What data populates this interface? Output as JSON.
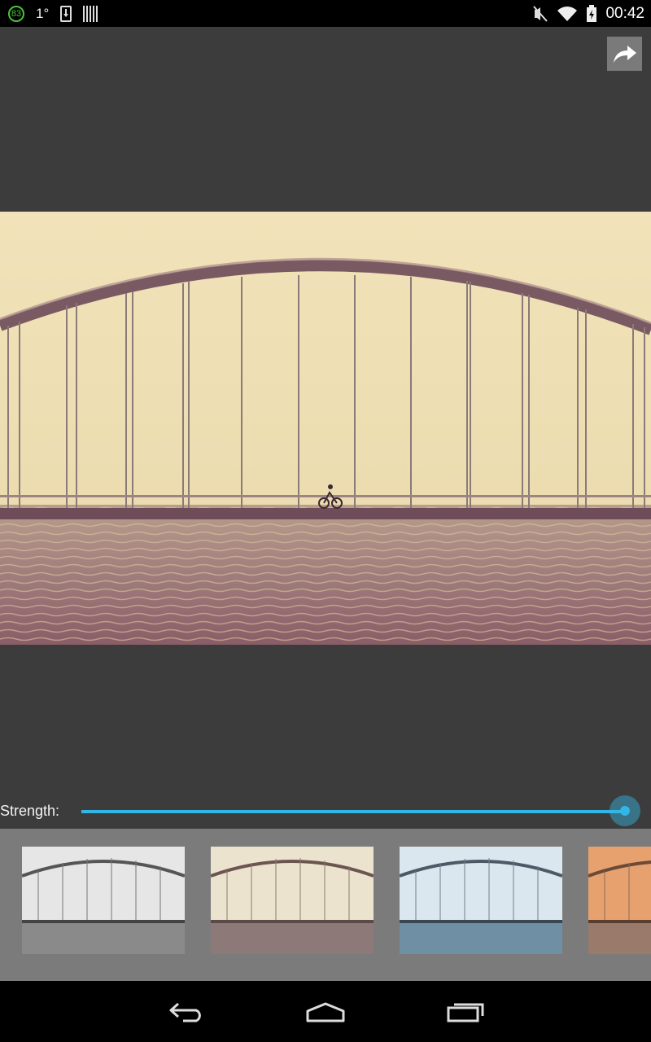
{
  "status_bar": {
    "battery_badge": "83",
    "temperature": "1°",
    "time": "00:42"
  },
  "editor": {
    "strength_label": "Strength:",
    "strength_value": 1.0,
    "accent_color": "#33b5e5",
    "photo_description_icon": "bridge-photo"
  },
  "filters": {
    "items": [
      {
        "name": "grayscale-filter",
        "tint": "#e6e6e6",
        "water": "#8a8a8a"
      },
      {
        "name": "sepia-filter",
        "tint": "#ece3cf",
        "water": "#8d7a78"
      },
      {
        "name": "cool-filter",
        "tint": "#dbe7ef",
        "water": "#6f8fa4"
      },
      {
        "name": "orange-filter",
        "tint": "#e7a16e",
        "water": "#9a7a6a"
      }
    ]
  },
  "nav": {
    "back_icon": "back-icon",
    "home_icon": "home-icon",
    "recents_icon": "recents-icon"
  }
}
